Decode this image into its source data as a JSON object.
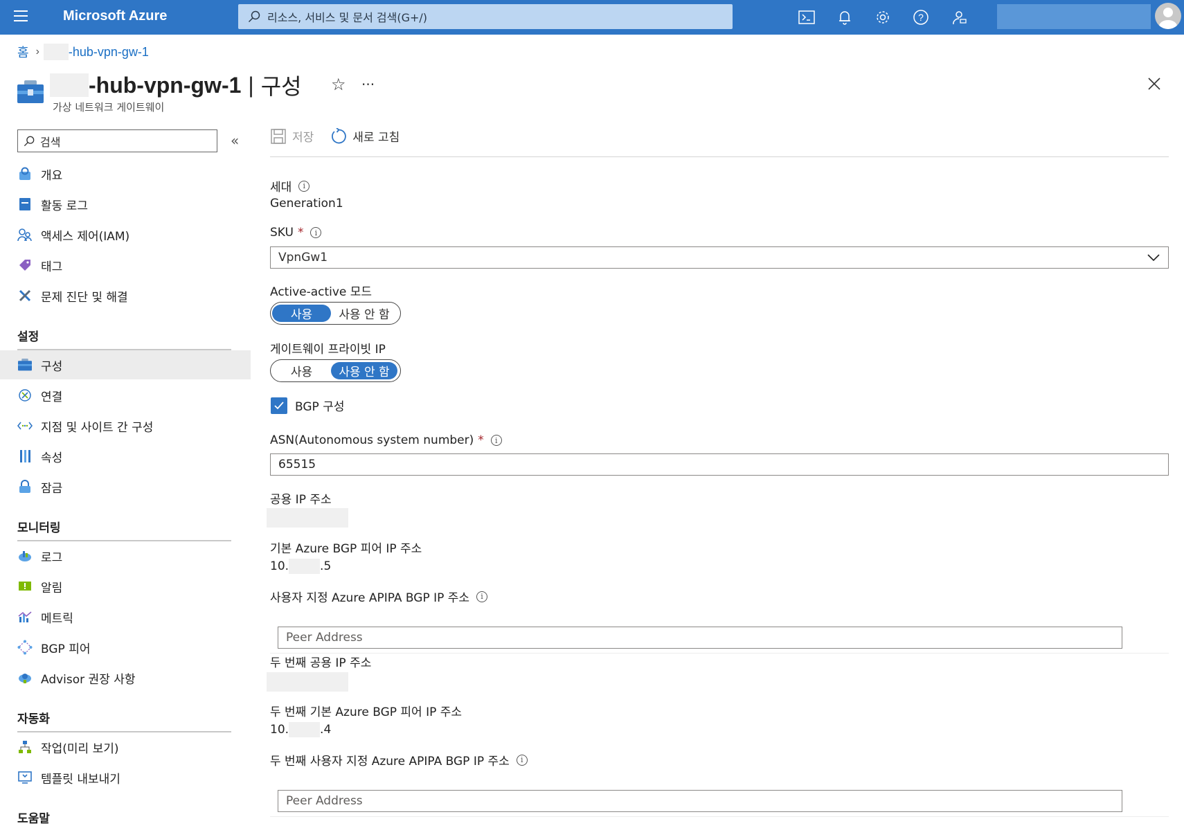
{
  "topbar": {
    "brand": "Microsoft Azure",
    "search_placeholder": "리소스, 서비스 및 문서 검색(G+/)",
    "icons": [
      "cloud-shell-icon",
      "notifications-icon",
      "settings-icon",
      "help-icon",
      "feedback-icon"
    ]
  },
  "breadcrumb": {
    "home": "홈",
    "resource": "-hub-vpn-gw-1"
  },
  "header": {
    "resource_name": "-hub-vpn-gw-1",
    "separator": "|",
    "section": "구성",
    "subtitle": "가상 네트워크 게이트웨이"
  },
  "sidebar": {
    "search_placeholder": "검색",
    "items_top": [
      {
        "label": "개요",
        "icon": "overview-icon"
      },
      {
        "label": "활동 로그",
        "icon": "activity-log-icon"
      },
      {
        "label": "액세스 제어(IAM)",
        "icon": "iam-icon"
      },
      {
        "label": "태그",
        "icon": "tag-icon"
      },
      {
        "label": "문제 진단 및 해결",
        "icon": "diagnose-icon"
      }
    ],
    "settings_heading": "설정",
    "settings_items": [
      {
        "label": "구성",
        "icon": "configuration-icon",
        "active": true
      },
      {
        "label": "연결",
        "icon": "connections-icon"
      },
      {
        "label": "지점 및 사이트 간 구성",
        "icon": "point-to-site-icon"
      },
      {
        "label": "속성",
        "icon": "properties-icon"
      },
      {
        "label": "잠금",
        "icon": "lock-icon"
      }
    ],
    "monitoring_heading": "모니터링",
    "monitoring_items": [
      {
        "label": "로그",
        "icon": "logs-icon"
      },
      {
        "label": "알림",
        "icon": "alerts-icon"
      },
      {
        "label": "메트릭",
        "icon": "metrics-icon"
      },
      {
        "label": "BGP 피어",
        "icon": "bgp-peers-icon"
      },
      {
        "label": "Advisor 권장 사항",
        "icon": "advisor-icon"
      }
    ],
    "automation_heading": "자동화",
    "automation_items": [
      {
        "label": "작업(미리 보기)",
        "icon": "tasks-icon"
      },
      {
        "label": "템플릿 내보내기",
        "icon": "export-template-icon"
      }
    ],
    "help_heading": "도움말"
  },
  "toolbar": {
    "save": "저장",
    "refresh": "새로 고침"
  },
  "form": {
    "generation_label": "세대",
    "generation_value": "Generation1",
    "sku_label": "SKU",
    "sku_value": "VpnGw1",
    "active_active_label": "Active-active 모드",
    "gateway_private_ip_label": "게이트웨이 프라이빗 IP",
    "toggle_enabled": "사용",
    "toggle_disabled": "사용 안 함",
    "active_active_selected": "사용",
    "gateway_private_ip_selected": "사용 안 함",
    "bgp_label": "BGP 구성",
    "bgp_checked": true,
    "asn_label": "ASN(Autonomous system number)",
    "asn_value": "65515",
    "public_ip_label": "공용 IP 주소",
    "default_bgp_label": "기본 Azure BGP 피어 IP 주소",
    "default_bgp_prefix": "10.",
    "default_bgp_suffix": ".5",
    "custom_apipa_label": "사용자 지정 Azure APIPA BGP IP 주소",
    "peer_placeholder": "Peer Address",
    "second_public_ip_label": "두 번째 공용 IP 주소",
    "second_default_bgp_label": "두 번째 기본 Azure BGP 피어 IP 주소",
    "second_default_bgp_prefix": "10.",
    "second_default_bgp_suffix": ".4",
    "second_custom_apipa_label": "두 번째 사용자 지정 Azure APIPA BGP IP 주소"
  },
  "colors": {
    "topbar": "#2f76c6",
    "accent": "#2f76c6",
    "required": "#a4262c"
  }
}
